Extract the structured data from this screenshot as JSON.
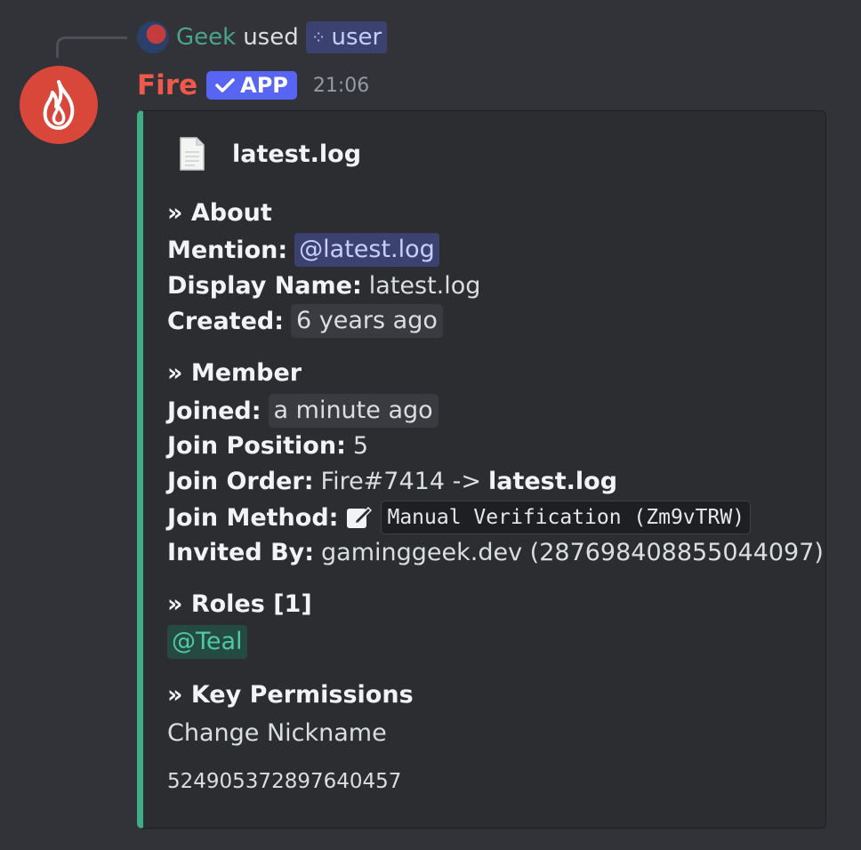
{
  "reply": {
    "user_name": "Geek",
    "used_text": "used",
    "command_name": "user",
    "command_icon": "slash-command-icon"
  },
  "message": {
    "bot_name": "Fire",
    "app_badge": "APP",
    "timestamp": "21:06",
    "accent_color": "#3fae87",
    "avatar_color": "#d9473b"
  },
  "embed": {
    "author": "latest.log",
    "about": {
      "heading": "» About",
      "mention_label": "Mention:",
      "mention_value": "@latest.log",
      "display_name_label": "Display Name:",
      "display_name_value": "latest.log",
      "created_label": "Created:",
      "created_value": "6 years ago"
    },
    "member": {
      "heading": "» Member",
      "joined_label": "Joined:",
      "joined_value": "a minute ago",
      "join_position_label": "Join Position:",
      "join_position_value": "5",
      "join_order_label": "Join Order:",
      "join_order_from": "Fire#7414 ->",
      "join_order_to": "latest.log",
      "join_method_label": "Join Method:",
      "join_method_value": "Manual Verification (Zm9vTRW)",
      "invited_by_label": "Invited By:",
      "invited_by_value": "gaminggeek.dev (287698408855044097)"
    },
    "roles": {
      "heading": "» Roles [1]",
      "items": [
        "@Teal"
      ]
    },
    "permissions": {
      "heading": "» Key Permissions",
      "value": "Change Nickname"
    },
    "footer": "524905372897640457"
  }
}
